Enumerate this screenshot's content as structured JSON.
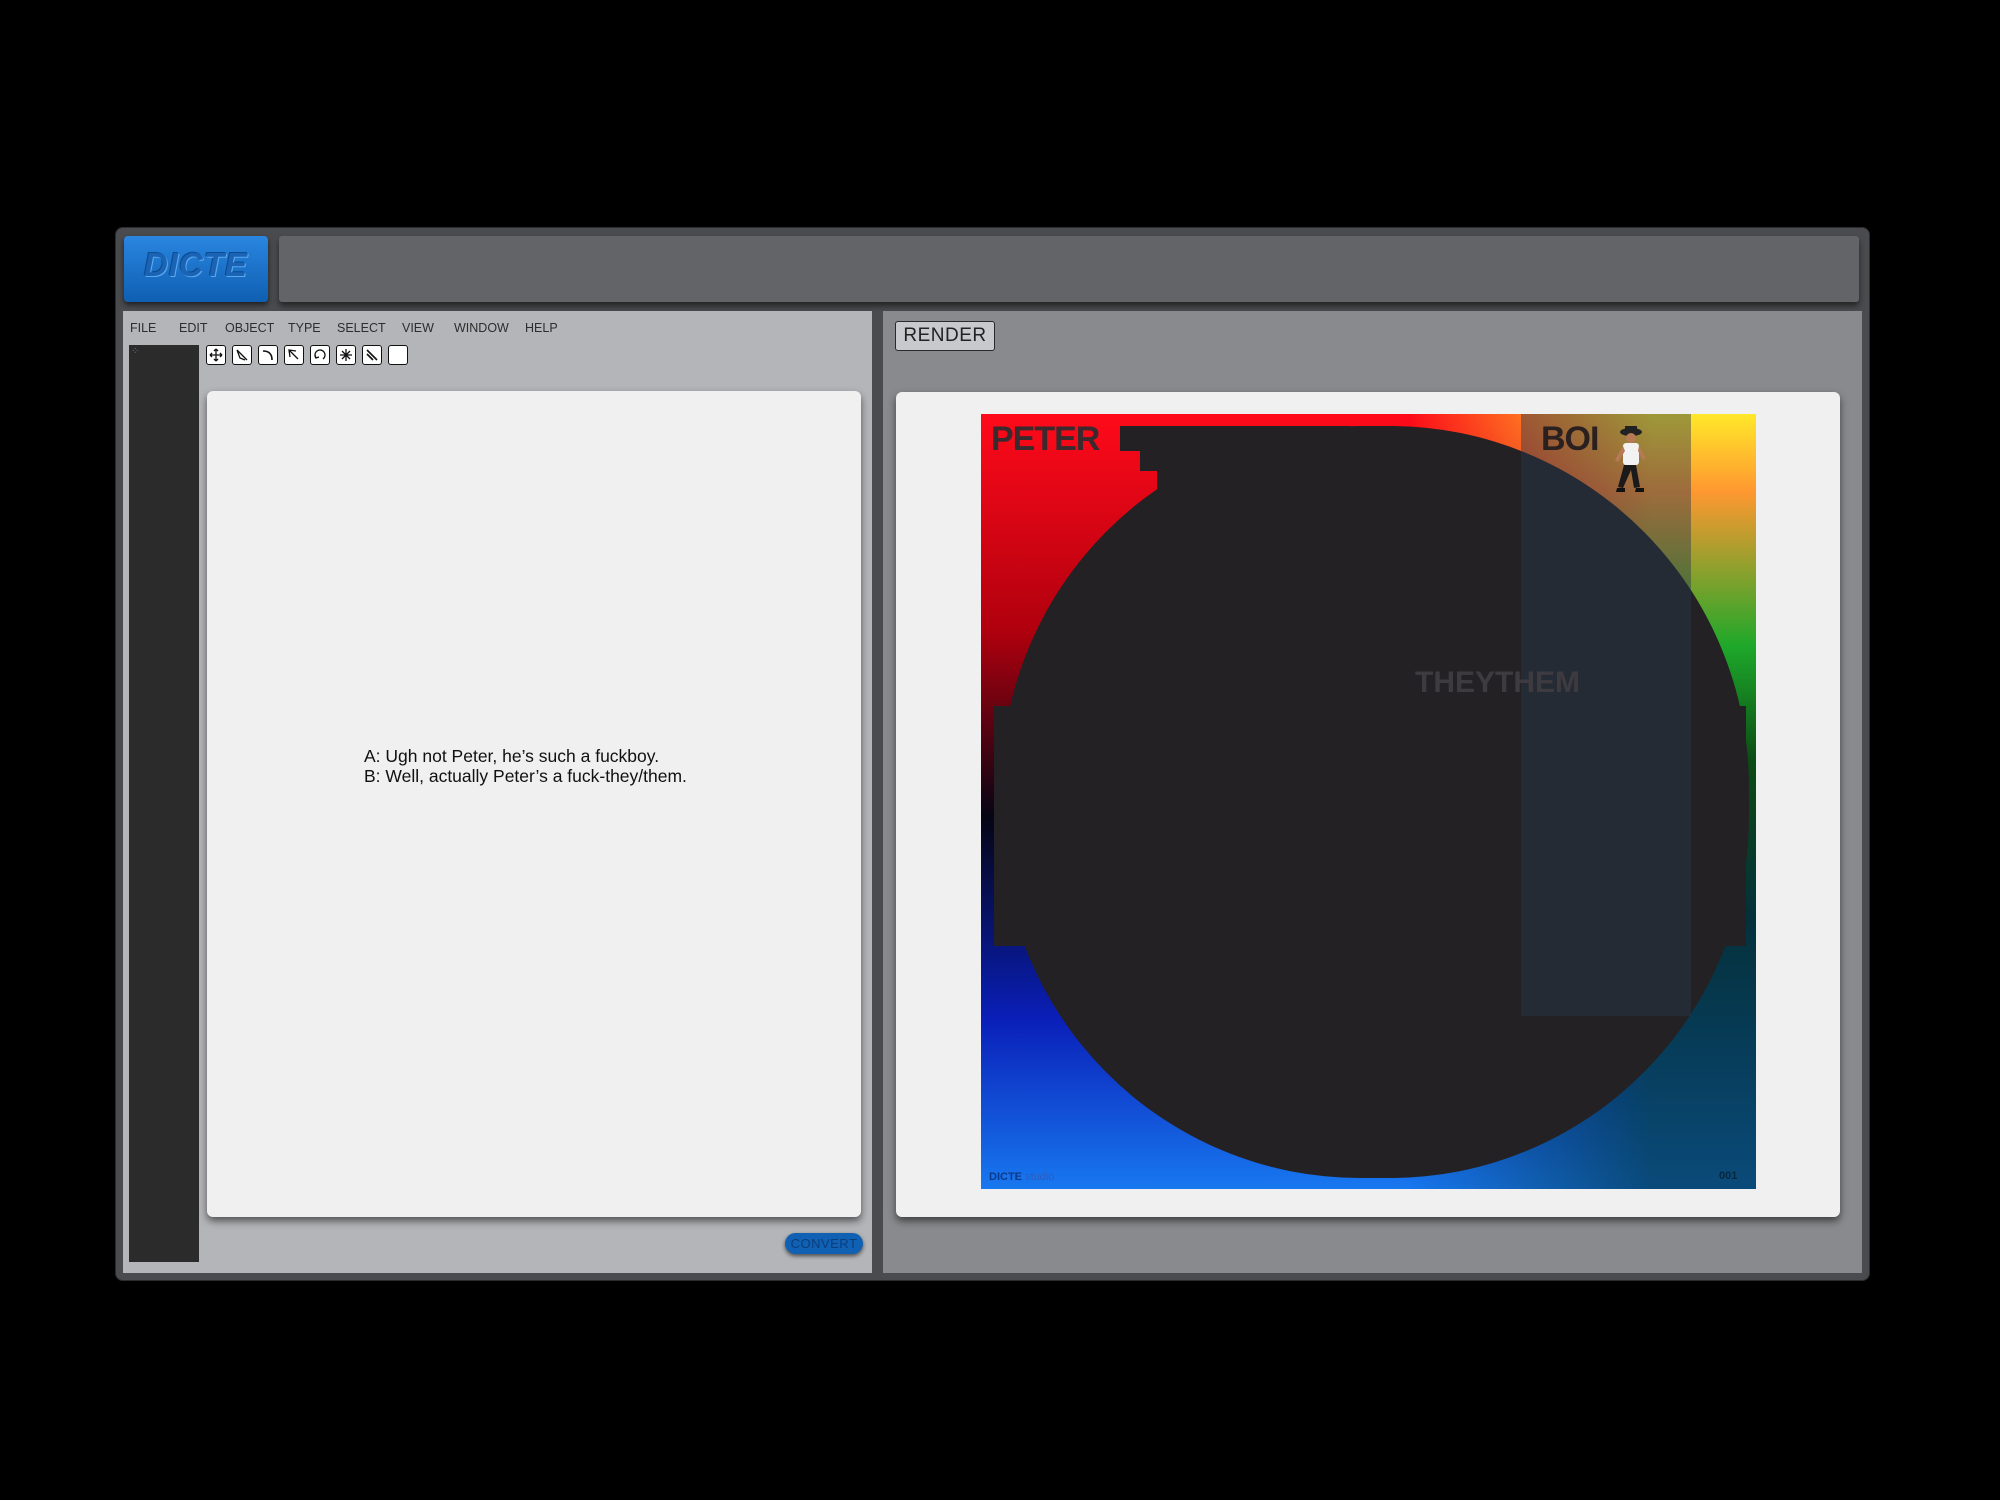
{
  "app": {
    "logo_text": "DICTE"
  },
  "menu": [
    "FILE",
    "EDIT",
    "OBJECT",
    "TYPE",
    "SELECT",
    "VIEW",
    "WINDOW",
    "HELP"
  ],
  "toolbar": {
    "tools": [
      "move-icon",
      "pen-icon",
      "curve-icon",
      "direct-select-icon",
      "rotate-icon",
      "sparkle-icon",
      "knife-icon",
      "blank-icon"
    ]
  },
  "editor": {
    "line1": "A: Ugh not Peter, he’s such a fuckboy.",
    "line2": "B: Well, actually Peter’s a fuck-they/them."
  },
  "convert_label": "CONVERT",
  "render_label": "RENDER",
  "poster": {
    "word1": "PETER",
    "word2": "BOI",
    "word3": "THEYTHEM",
    "footer_brand": "DICTE",
    "footer_sub": "studio",
    "footer_number": "001"
  },
  "colors": {
    "accent_blue": "#1060b3",
    "window_bg": "#4a4b4e",
    "left_pane": "#b4b5b8",
    "right_pane": "#898a8d"
  }
}
